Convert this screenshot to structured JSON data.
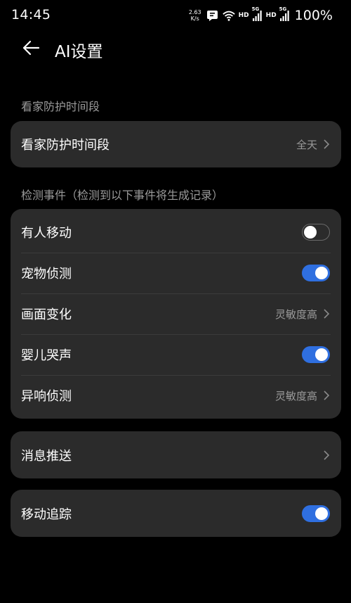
{
  "status_bar": {
    "time": "14:45",
    "speed_value": "2.63",
    "speed_unit": "K/s",
    "hd1": "HD",
    "gen1": "5G",
    "hd2": "HD",
    "gen2": "5G",
    "battery": "100%"
  },
  "header": {
    "title": "AI设置"
  },
  "section1": {
    "label": "看家防护时间段",
    "row": {
      "label": "看家防护时间段",
      "value": "全天"
    }
  },
  "section2": {
    "label": "检测事件（检测到以下事件将生成记录）",
    "rows": [
      {
        "label": "有人移动",
        "toggle": "off"
      },
      {
        "label": "宠物侦测",
        "toggle": "on"
      },
      {
        "label": "画面变化",
        "value": "灵敏度高"
      },
      {
        "label": "婴儿哭声",
        "toggle": "on"
      },
      {
        "label": "异响侦测",
        "value": "灵敏度高"
      }
    ]
  },
  "message_push": {
    "label": "消息推送"
  },
  "motion_tracking": {
    "label": "移动追踪",
    "toggle": "on"
  },
  "colors": {
    "accent": "#2f6fe0",
    "card": "#2b2b2b",
    "background": "#000000"
  }
}
